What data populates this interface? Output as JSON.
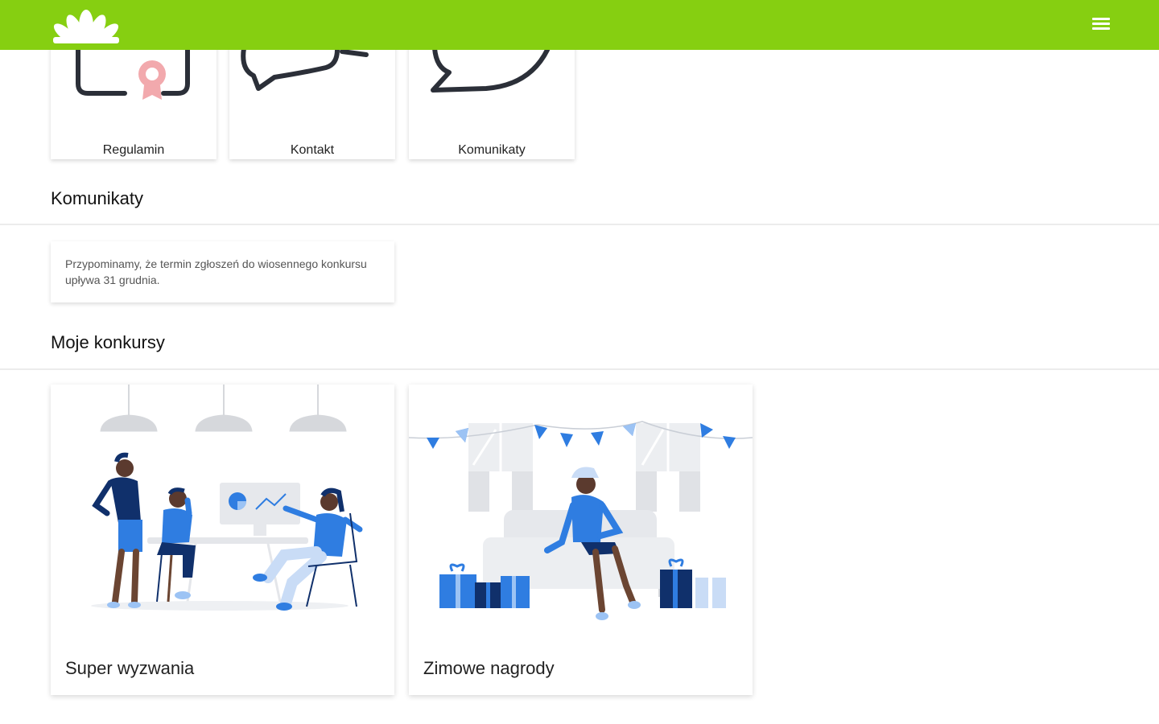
{
  "header": {
    "logo_icon": "flower-logo-icon",
    "menu_icon": "hamburger-menu-icon",
    "bar_color": "#86cf11"
  },
  "tiles": [
    {
      "label": "Regulamin",
      "icon": "certificate-icon"
    },
    {
      "label": "Kontakt",
      "icon": "chat-bubbles-icon"
    },
    {
      "label": "Komunikaty",
      "icon": "speech-bubble-icon"
    }
  ],
  "announcements": {
    "title": "Komunikaty",
    "items": [
      {
        "text": "Przypominamy, że termin zgłoszeń do wiosennego konkursu upływa 31 grudnia."
      }
    ]
  },
  "contests": {
    "title": "Moje konkursy",
    "items": [
      {
        "title": "Super wyzwania",
        "image": "team-meeting-illustration"
      },
      {
        "title": "Zimowe nagrody",
        "image": "party-gifts-illustration"
      }
    ]
  },
  "colors": {
    "accent": "#86cf11",
    "illustration_blue": "#2f7de1",
    "illustration_navy": "#10306b",
    "icon_dark": "#2b2f38",
    "icon_pink": "#f2a9ad"
  }
}
